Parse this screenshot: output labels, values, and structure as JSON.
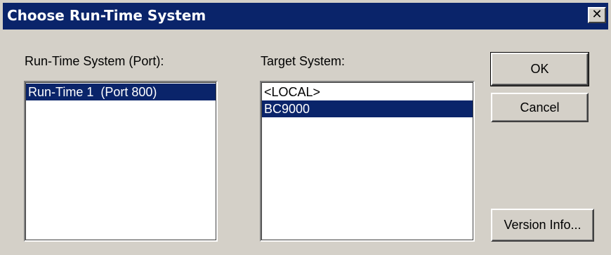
{
  "dialog": {
    "title": "Choose Run-Time System",
    "close_glyph": "✕"
  },
  "runtime": {
    "label": "Run-Time System (Port):",
    "items": [
      "Run-Time 1  (Port 800)"
    ],
    "selected_index": 0
  },
  "target": {
    "label": "Target System:",
    "items": [
      "<LOCAL>",
      "BC9000"
    ],
    "selected_index": 1
  },
  "buttons": {
    "ok": "OK",
    "cancel": "Cancel",
    "version_info": "Version Info..."
  },
  "colors": {
    "titlebar": "#0a246a",
    "face": "#d4d0c8",
    "selection": "#0a246a"
  }
}
